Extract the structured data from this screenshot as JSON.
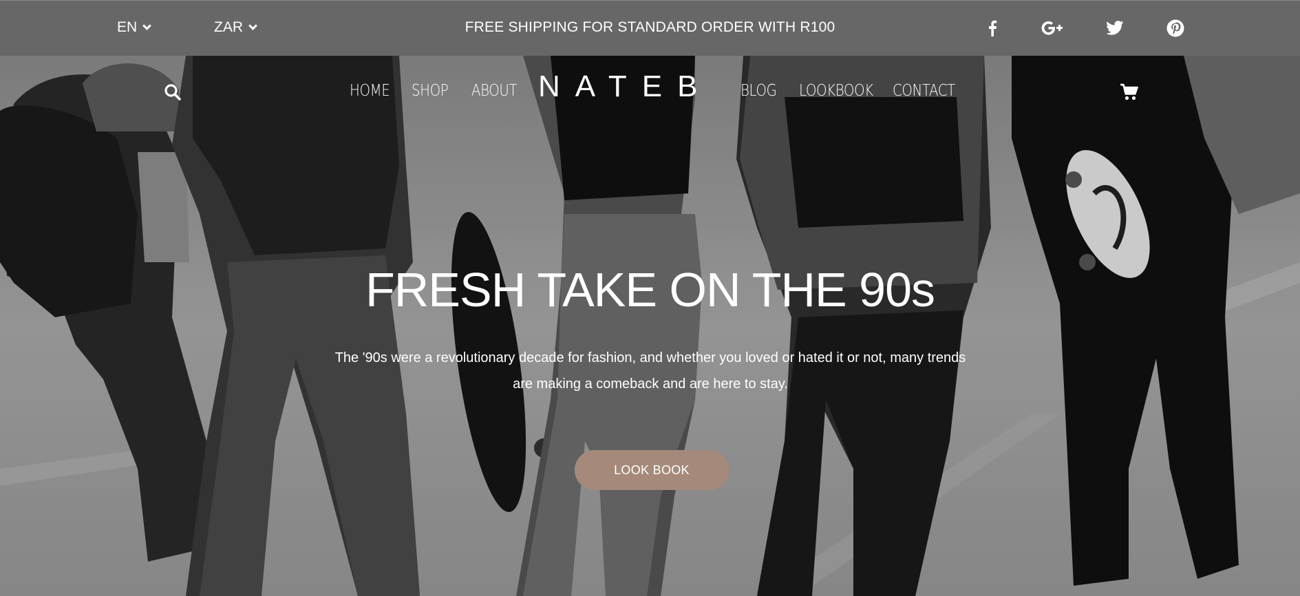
{
  "topbar": {
    "language": "EN",
    "currency": "ZAR",
    "shipping_notice": "FREE SHIPPING FOR STANDARD ORDER WITH R100",
    "social": [
      "facebook-icon",
      "google-plus-icon",
      "twitter-icon",
      "pinterest-icon"
    ]
  },
  "nav": {
    "left": [
      "HOME",
      "SHOP",
      "ABOUT"
    ],
    "logo": "NATEB",
    "right": [
      "BLOG",
      "LOOKBOOK",
      "CONTACT"
    ],
    "icons": [
      "search-icon",
      "cart-icon"
    ]
  },
  "hero": {
    "headline": "FRESH TAKE ON THE 90s",
    "description": "The '90s were a revolutionary decade for fashion, and whether you loved or hated it or not, many trends are making a comeback and are here to stay.",
    "cta_label": "LOOK BOOK"
  },
  "colors": {
    "topbar_bg": "#676767",
    "cta_bg": "#a58a7b",
    "text": "#ffffff"
  }
}
